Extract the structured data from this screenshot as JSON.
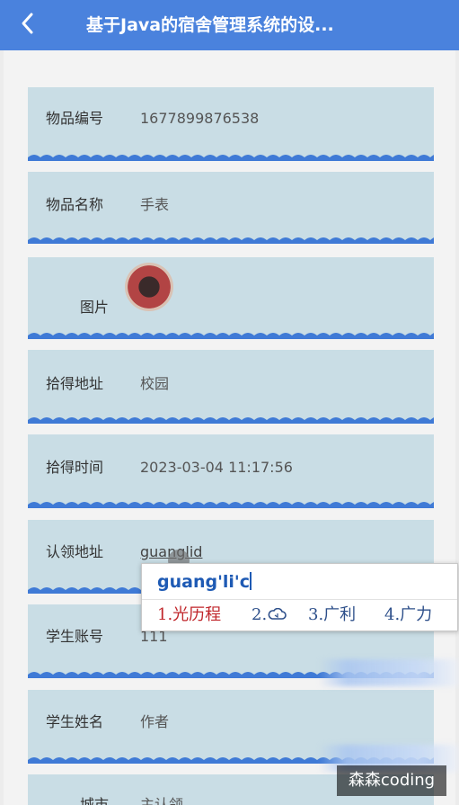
{
  "header": {
    "title": "基于Java的宿舍管理系统的设..."
  },
  "fields": [
    {
      "label": "物品编号",
      "value": "1677899876538"
    },
    {
      "label": "物品名称",
      "value": "手表"
    },
    {
      "label": "图片"
    },
    {
      "label": "拾得地址",
      "value": "校园"
    },
    {
      "label": "拾得时间",
      "value": "2023-03-04 11:17:56"
    },
    {
      "label": "认领地址",
      "value": "guanglid"
    },
    {
      "label": "学生账号",
      "value": "111"
    },
    {
      "label": "学生姓名",
      "value": "作者"
    },
    {
      "label": "城市",
      "value": "主认领"
    }
  ],
  "ime": {
    "composition": "guang'li'c",
    "candidates": [
      {
        "label": "1.光历程",
        "selected": true
      },
      {
        "label": "2.",
        "icon": "cloud-icon"
      },
      {
        "label": "3.广利"
      },
      {
        "label": "4.广力"
      }
    ]
  },
  "watermark": "森森coding",
  "colors": {
    "header": "#4a82dd",
    "field_background": "#c9dde5",
    "wave": "#3f7ad6",
    "selected_candidate": "#c0262b",
    "candidate": "#2d4f8a"
  }
}
